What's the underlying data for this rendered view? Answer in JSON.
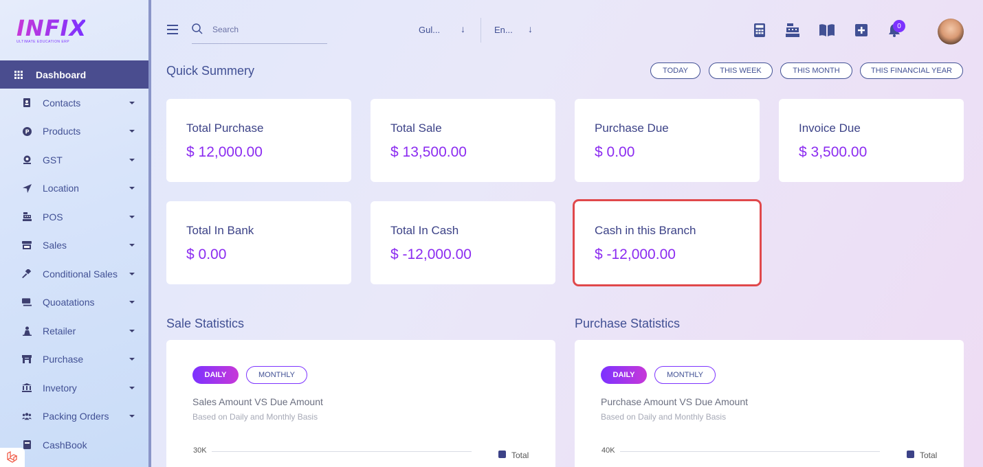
{
  "brand": {
    "logo_text": "INFIX",
    "logo_sub": "ULTIMATE EDUCATION ERP"
  },
  "sidebar": {
    "items": [
      {
        "label": "Dashboard",
        "icon": "grid-icon",
        "active": true
      },
      {
        "label": "Contacts",
        "icon": "address-book-icon"
      },
      {
        "label": "Products",
        "icon": "product-icon"
      },
      {
        "label": "GST",
        "icon": "tax-icon"
      },
      {
        "label": "Location",
        "icon": "location-arrow-icon"
      },
      {
        "label": "POS",
        "icon": "cash-register-icon"
      },
      {
        "label": "Sales",
        "icon": "store-icon"
      },
      {
        "label": "Conditional Sales",
        "icon": "gavel-icon"
      },
      {
        "label": "Quoatations",
        "icon": "quotation-icon"
      },
      {
        "label": "Retailer",
        "icon": "retailer-icon"
      },
      {
        "label": "Purchase",
        "icon": "purchase-store-icon"
      },
      {
        "label": "Invetory",
        "icon": "bank-icon"
      },
      {
        "label": "Packing Orders",
        "icon": "users-icon"
      },
      {
        "label": "CashBook",
        "icon": "book-icon"
      }
    ]
  },
  "header": {
    "search": {
      "placeholder": "Search",
      "value": ""
    },
    "branch_select": "Gul...",
    "language_select": "En...",
    "notification_count": "0",
    "icons": [
      "calculator-icon",
      "cash-register-icon",
      "book-open-icon",
      "plus-square-icon",
      "bell-icon"
    ]
  },
  "summary": {
    "title": "Quick Summery",
    "periods": [
      "TODAY",
      "THIS WEEK",
      "THIS MONTH",
      "THIS FINANCIAL YEAR"
    ],
    "cards": [
      {
        "label": "Total Purchase",
        "value": "$ 12,000.00"
      },
      {
        "label": "Total Sale",
        "value": "$ 13,500.00"
      },
      {
        "label": "Purchase Due",
        "value": "$ 0.00"
      },
      {
        "label": "Invoice Due",
        "value": "$ 3,500.00"
      },
      {
        "label": "Total In Bank",
        "value": "$ 0.00"
      },
      {
        "label": "Total In Cash",
        "value": "$ -12,000.00"
      },
      {
        "label": "Cash in this Branch",
        "value": "$ -12,000.00"
      }
    ]
  },
  "sale_stats": {
    "title": "Sale Statistics",
    "tab_daily": "DAILY",
    "tab_monthly": "MONTHLY",
    "chart_title": "Sales Amount VS Due Amount",
    "chart_subtitle": "Based on Daily and Monthly Basis",
    "y_top_label": "30K",
    "legend": "Total"
  },
  "purchase_stats": {
    "title": "Purchase Statistics",
    "tab_daily": "DAILY",
    "tab_monthly": "MONTHLY",
    "chart_title": "Purchase Amount VS Due Amount",
    "chart_subtitle": "Based on Daily and Monthly Basis",
    "y_top_label": "40K",
    "legend": "Total"
  },
  "colors": {
    "accent": "#7c32ff",
    "brand_pink": "#c738d8",
    "text": "#415094",
    "highlight_border": "#e0484b"
  }
}
